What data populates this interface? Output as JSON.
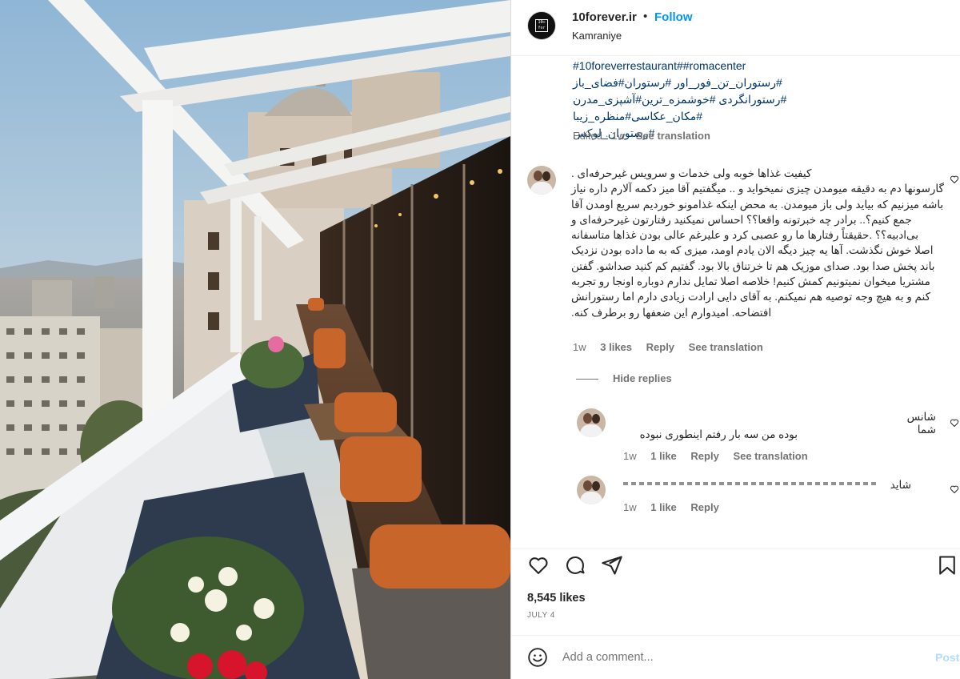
{
  "post": {
    "username": "10forever.ir",
    "separator": "•",
    "follow_label": "Follow",
    "location": "Kamraniye",
    "avatar_logo_text": "10 ∞\nforever"
  },
  "caption": {
    "hashtag_line_1": "#10foreverrestaurant##romacenter",
    "hashtag_line_2": "#رستوران_تن_فور_اور #رستوران#فضای_باز",
    "hashtag_line_3": "#رستورانگردی #خوشمزه_ترین#آشپزی_مدرن #مکان_عکاسی#منظره_زیبا",
    "hashtag_line_4": "#رستوران_لوکس",
    "edited": "Edited",
    "time_sep": "·",
    "time": "1w",
    "see_translation": "See translation"
  },
  "comment_main": {
    "line_1": "کیفیت غذاها خوبه ولی خدمات و سرویس غیرحرفه‌ای .",
    "line_2": "گارسونها دم به دقیقه میومدن چیزی نمیخواید و .. میگفتیم آقا میز دکمه آلارم داره نیاز",
    "line_3": "باشه میزنیم که بیاید ولی باز میومدن. به محض اینکه غذامونو خوردیم سریع اومدن آقا",
    "line_4": "جمع کنیم؟.. برادر چه خبرتونه واقعا؟؟ احساس نمیکنید رفتارتون غیرحرفه‌ای و",
    "line_5": "بی‌ادبیه؟؟ .حقیقتاً رفتارها ما رو عصبی کرد و علیرغم عالی بودن غذاها متاسفانه",
    "line_6": "اصلا خوش نگذشت. آها یه چیز دیگه الان یادم اومد، میزی که به ما داده بودن نزدیک",
    "line_7": "باند پخش صدا بود. صدای موزیک هم تا خرتناق بالا بود. گفتیم کم کنید صداشو. گفتن",
    "line_8": "مشتریا میخوان نمیتونیم کمش کنیم! خلاصه اصلا تمایل ندارم دوباره اونجا رو تجربه",
    "line_9": "کنم و به هیچ وجه توصیه هم نمیکنم. به آقای دایی ارادت زیادی دارم اما رستورانش",
    "line_10": "افتضاحه. امیدوارم این ضعفها رو برطرف کنه.",
    "time": "1w",
    "likes": "3 likes",
    "reply": "Reply",
    "see_translation": "See translation"
  },
  "hide_replies_label": "Hide replies",
  "reply_1": {
    "name": "شانس شما",
    "body": "بوده من سه بار رفتم اینطوری نبوده",
    "time": "1w",
    "likes": "1 like",
    "reply": "Reply",
    "see_translation": "See translation"
  },
  "reply_2": {
    "name": "شاید",
    "time": "1w",
    "likes": "1 like",
    "reply": "Reply"
  },
  "actions": {
    "icons": [
      "heart-icon",
      "comment-icon",
      "share-icon",
      "bookmark-icon"
    ],
    "likes": "8,545 likes",
    "date": "JULY 4"
  },
  "comment_form": {
    "placeholder": "Add a comment...",
    "post_label": "Post"
  },
  "colors": {
    "link_blue": "#0095f6",
    "hashtag_blue": "#00376b",
    "secondary_text": "#737373",
    "post_disabled": "#b3dbff"
  }
}
